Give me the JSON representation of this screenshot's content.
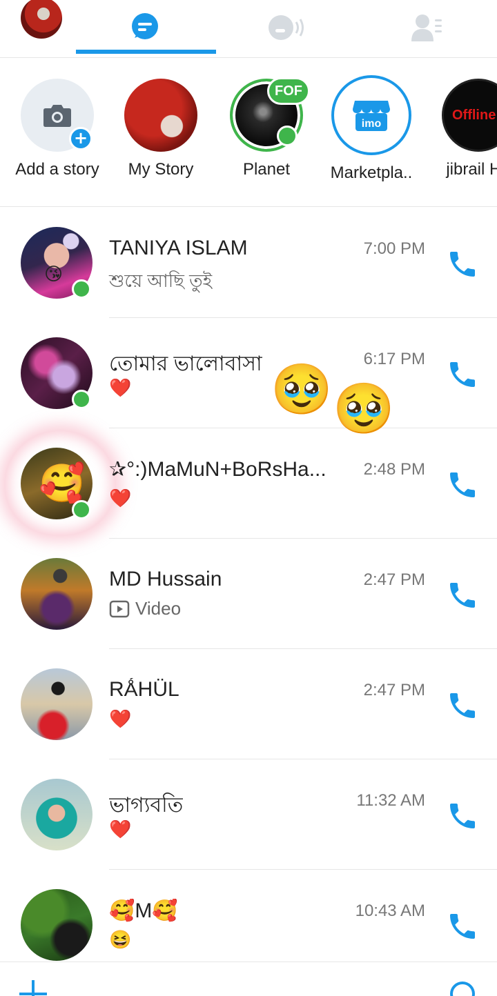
{
  "header": {
    "tabs": [
      {
        "name": "chats",
        "icon": "chat-bubble-icon",
        "active": true
      },
      {
        "name": "calls",
        "icon": "voice-room-icon",
        "active": false
      },
      {
        "name": "contacts",
        "icon": "contacts-icon",
        "active": false
      }
    ],
    "accent_color": "#1a98e8"
  },
  "stories": [
    {
      "label": "Add a story",
      "icon": "camera-icon"
    },
    {
      "label": "My Story"
    },
    {
      "label": "Planet",
      "badge": "FOF"
    },
    {
      "label": "Marketpla..",
      "logo_text": "imo"
    },
    {
      "label": "jibrail Ho",
      "overlay_text": "Offline"
    }
  ],
  "chats": [
    {
      "name": "TANIYA ISLAM",
      "message": "শুয়ে আছি তুই",
      "time": "7:00 PM",
      "online": true
    },
    {
      "name": "তোমার ভালোবাসা",
      "message": "❤️",
      "time": "6:17 PM",
      "online": true
    },
    {
      "name": "✰°:)MaMuN+BoRsHa...",
      "message": "❤️",
      "time": "2:48 PM",
      "online": true
    },
    {
      "name": "MD Hussain",
      "message": "Video",
      "time": "2:47 PM",
      "online": false
    },
    {
      "name": "RǺHÜL",
      "message": "❤️",
      "time": "2:47 PM",
      "online": false
    },
    {
      "name": "ভাগ্যবতি",
      "message": "❤️",
      "time": "11:32 AM",
      "online": false
    },
    {
      "name": "🥰M🥰",
      "message": "😆",
      "time": "10:43 AM",
      "online": false
    }
  ],
  "floating": {
    "emoji": "🥹"
  }
}
